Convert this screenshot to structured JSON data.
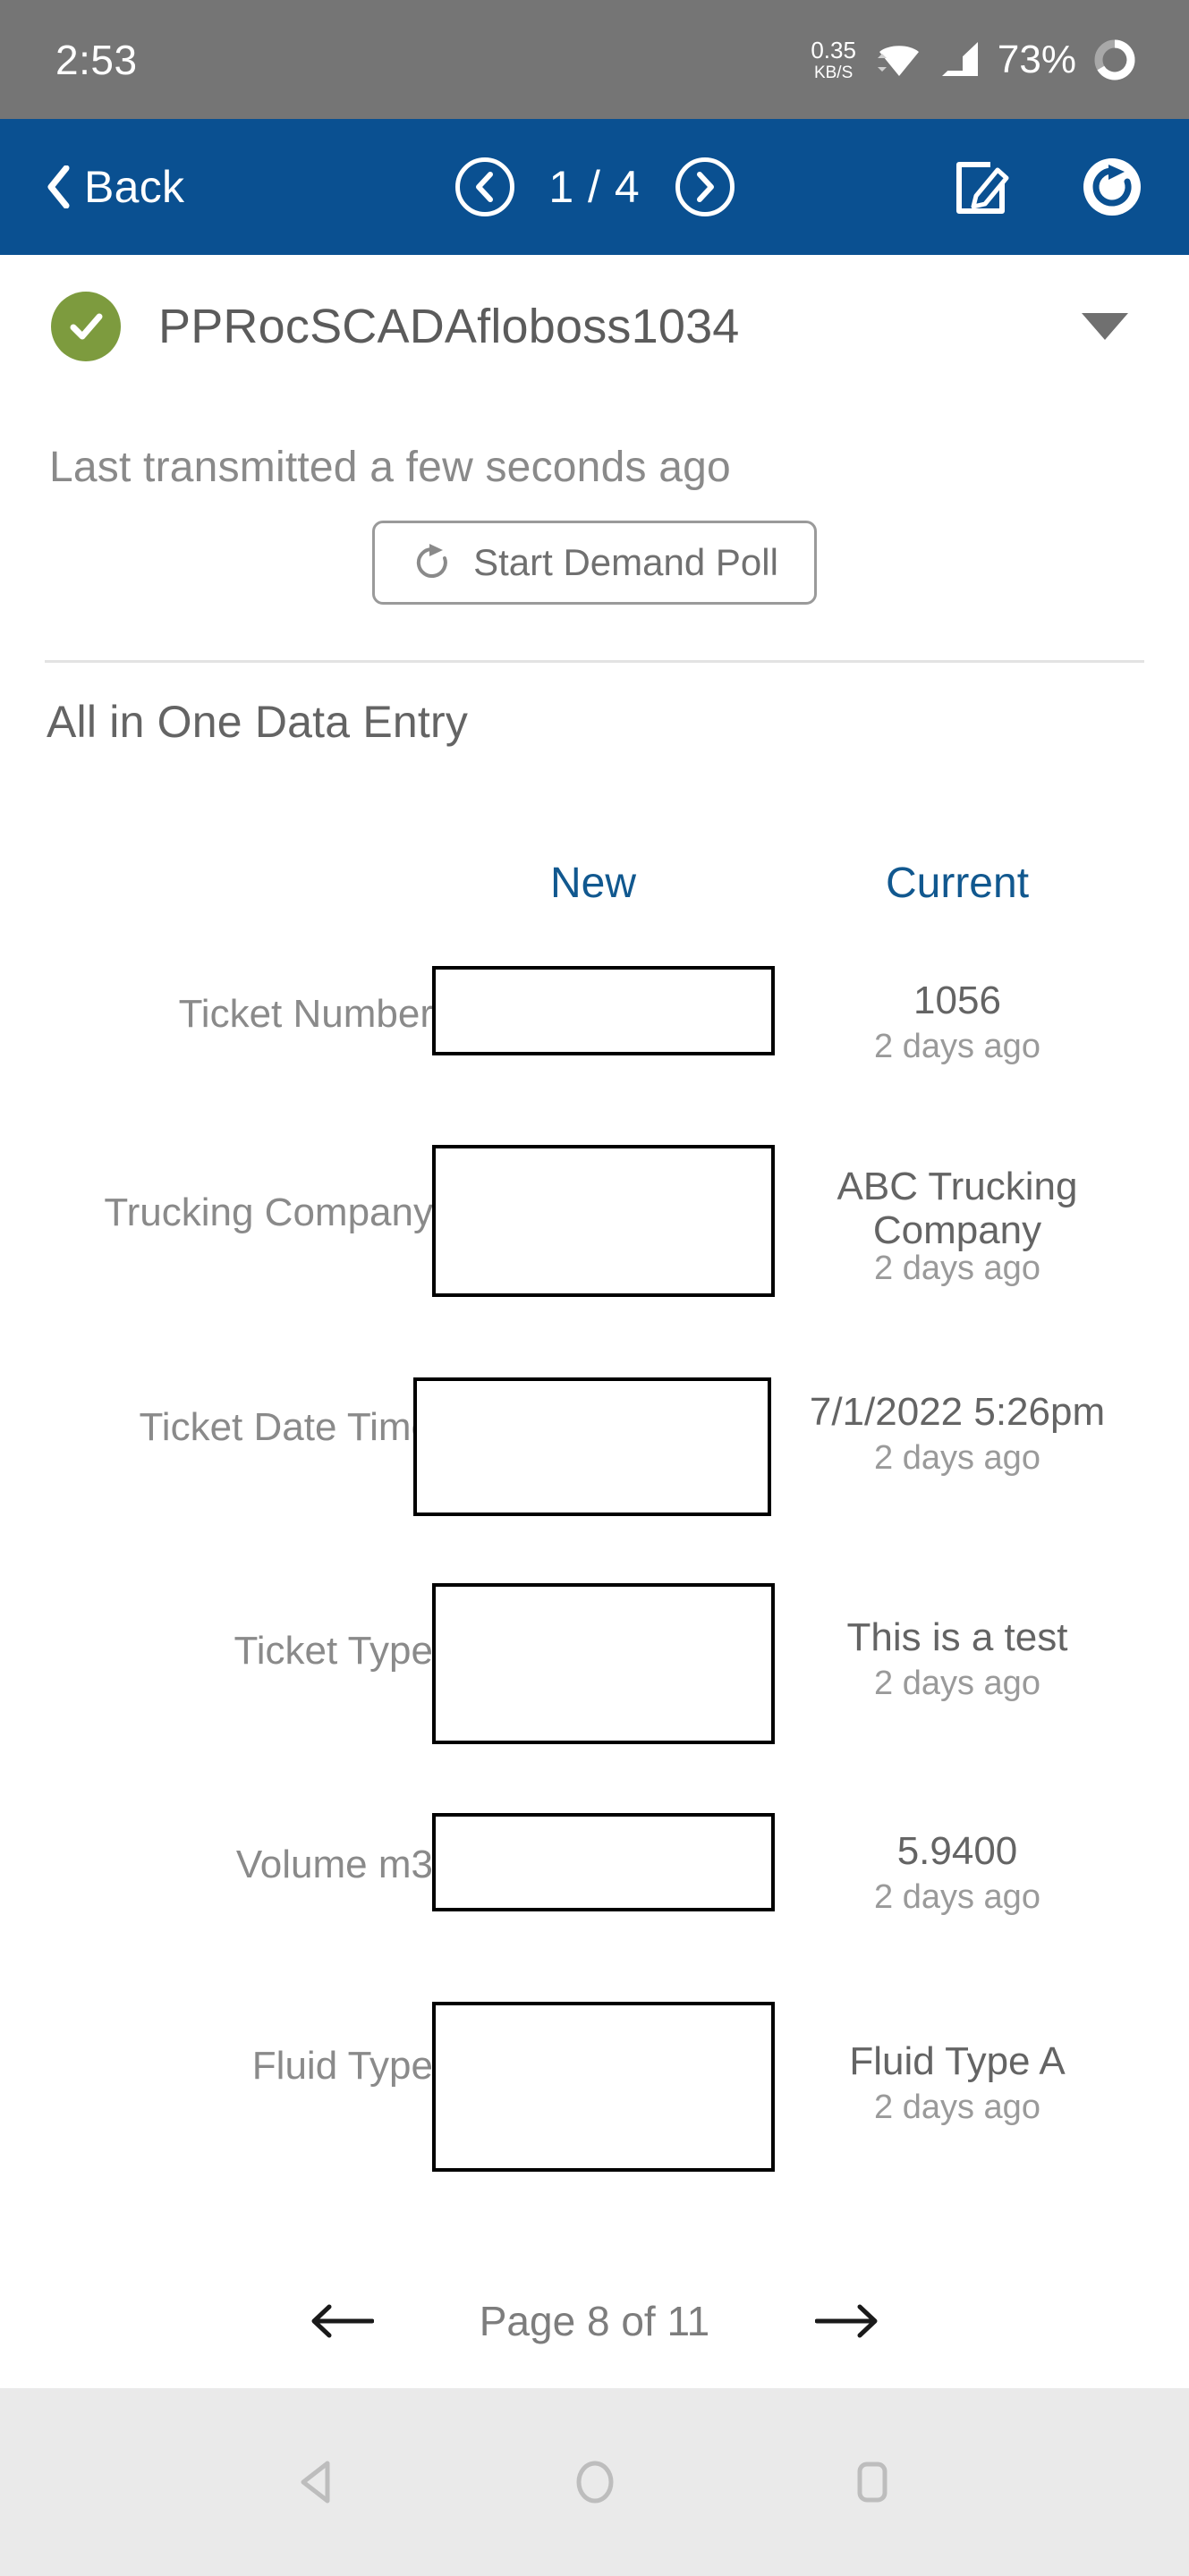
{
  "status_bar": {
    "clock": "2:53",
    "net_rate": "0.35",
    "net_unit": "KB/S",
    "battery": "73%",
    "icons": [
      "wifi-icon",
      "cellular-signal-icon",
      "battery-ring-icon"
    ]
  },
  "app_bar": {
    "back_label": "Back",
    "page_indicator": "1 / 4",
    "prev_icon": "chevron-left-circle-icon",
    "next_icon": "chevron-right-circle-icon",
    "edit_icon": "edit-pencil-icon",
    "refresh_icon": "refresh-circle-icon"
  },
  "device": {
    "status_icon": "check-circle-icon",
    "name": "PPRocSCADAfloboss1034",
    "expand_icon": "caret-down-icon",
    "last_transmitted": "Last transmitted a few seconds ago",
    "poll_button": "Start Demand Poll",
    "poll_icon": "rotate-refresh-icon"
  },
  "section": {
    "title": "All in One Data Entry",
    "columns": {
      "new": "New",
      "current": "Current"
    },
    "rows": [
      {
        "label": "Ticket Number",
        "new_value": "",
        "current_value": "1056",
        "ago": "2 days ago"
      },
      {
        "label": "Trucking Company",
        "new_value": "",
        "current_value": "ABC Trucking Company",
        "ago": "2 days ago"
      },
      {
        "label": "Ticket Date Time",
        "new_value": "",
        "current_value": "7/1/2022 5:26pm",
        "ago": "2 days ago"
      },
      {
        "label": "Ticket Type",
        "new_value": "",
        "current_value": "This is a test",
        "ago": "2 days ago"
      },
      {
        "label": "Volume m3",
        "new_value": "",
        "current_value": "5.9400",
        "ago": "2 days ago"
      },
      {
        "label": "Fluid Type",
        "new_value": "",
        "current_value": "Fluid Type A",
        "ago": "2 days ago"
      }
    ]
  },
  "pagination": {
    "prev_icon": "arrow-left-icon",
    "label": "Page 8 of 11",
    "next_icon": "arrow-right-icon"
  },
  "android_nav": {
    "back_icon": "triangle-back-icon",
    "home_icon": "circle-home-icon",
    "recents_icon": "square-recents-icon"
  },
  "colors": {
    "appbar_blue": "#0a5091",
    "status_gray": "#757575",
    "accent_green": "#7d9b3e",
    "column_header_blue": "#11588f",
    "navbar_gray": "#eaeaea"
  }
}
